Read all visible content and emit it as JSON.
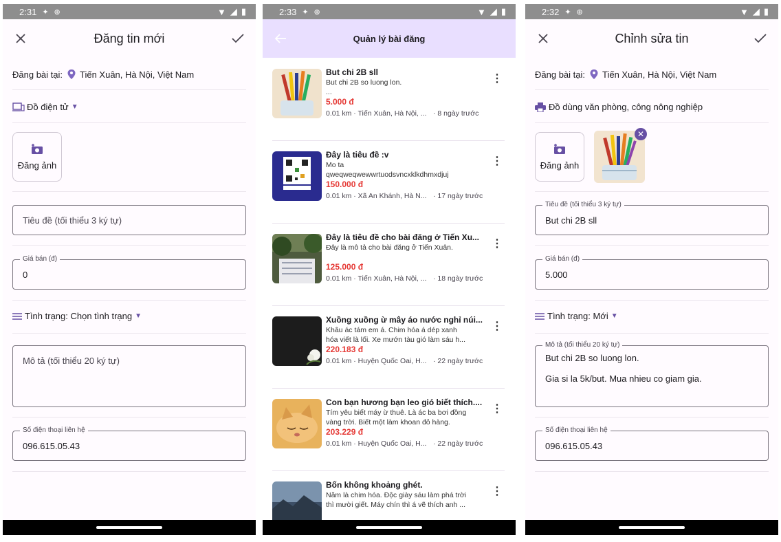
{
  "screens": {
    "create": {
      "status_time": "2:31",
      "title": "Đăng tin mới",
      "location_label": "Đăng bài tại:",
      "location_value": "Tiến Xuân, Hà Nội, Việt Nam",
      "category": "Đồ điện tử",
      "photo_button": "Đăng ảnh",
      "title_placeholder": "Tiêu đề (tối thiểu 3 ký tự)",
      "price_label": "Giá bán (đ)",
      "price_value": "0",
      "condition_text": "Tình trạng: Chọn tình trạng",
      "desc_placeholder": "Mô tả (tối thiểu 20 ký tự)",
      "phone_label": "Số điện thoại liên hệ",
      "phone_value": "096.615.05.43"
    },
    "manage": {
      "status_time": "2:33",
      "title": "Quản lý bài đăng",
      "items": [
        {
          "title": "But chi 2B sll",
          "desc": "But chi 2B so luong lon.\n...",
          "price": "5.000 đ",
          "location": "0.01 km · Tiến Xuân, Hà Nội, ...",
          "time": "· 8 ngày trước",
          "thumb": "pencils"
        },
        {
          "title": "Đây là tiêu đề :v",
          "desc": "Mo ta\nqweqweqwewwrtuodsvncxklkdhmxdjuj",
          "price": "150.000 đ",
          "location": "0.01 km · Xã An Khánh, Hà N...",
          "time": "· 17 ngày trước",
          "thumb": "qr"
        },
        {
          "title": "Đây là tiêu đề cho bài đăng ở Tiến Xu...",
          "desc": "Đây là mô tả cho bài đăng ở Tiến Xuân.",
          "price": "125.000 đ",
          "location": "0.01 km · Tiến Xuân, Hà Nội, ...",
          "time": "· 18 ngày trước",
          "thumb": "building"
        },
        {
          "title": "Xuồng xuồng ừ mây áo nước nghỉ núi...",
          "desc": "Khâu ác tám em á. Chim hóa á dép xanh\nhóa viết là lối. Xe mướn tàu gió làm sáu h...",
          "price": "220.183 đ",
          "location": "0.01 km · Huyện Quốc Oai, H...",
          "time": "· 22 ngày trước",
          "thumb": "flower"
        },
        {
          "title": "Con bạn hương bạn leo gió biết thích....",
          "desc": "Tím yêu biết máy ừ thuê. Là ác ba bơi đồng\nvàng trời. Biết một làm khoan đỏ hàng.",
          "price": "203.229 đ",
          "location": "0.01 km · Huyện Quốc Oai, H...",
          "time": "· 22 ngày trước",
          "thumb": "cat"
        },
        {
          "title": "Bốn không khoảng ghét.",
          "desc": "Năm là chim hóa. Độc giày sáu làm phá trời\nthì mười giết. Máy chín thì á vẽ thích anh ...",
          "price": "",
          "location": "",
          "time": "",
          "thumb": "landscape"
        }
      ]
    },
    "edit": {
      "status_time": "2:32",
      "title": "Chỉnh sửa tin",
      "location_label": "Đăng bài tại:",
      "location_value": "Tiến Xuân, Hà Nội, Việt Nam",
      "category": "Đồ dùng văn phòng, công nông nghiệp",
      "photo_button": "Đăng ảnh",
      "title_label": "Tiêu đề (tối thiểu 3 ký tự)",
      "title_value": "But chi 2B sll",
      "price_label": "Giá bán (đ)",
      "price_value": "5.000",
      "condition_text": "Tình trạng: Mới",
      "desc_label": "Mô tả (tối thiểu 20 ký tự)",
      "desc_value_line1": "But chi 2B so luong lon.",
      "desc_value_line2": "Gia si la 5k/but. Mua nhieu co giam gia.",
      "phone_label": "Số điện thoại liên hệ",
      "phone_value": "096.615.05.43"
    }
  },
  "colors": {
    "accent": "#6750a4",
    "price": "#e53935",
    "appbar_list": "#e9dfff"
  },
  "icons": [
    "close-icon",
    "check-icon",
    "back-arrow-icon",
    "location-pin-icon",
    "devices-icon",
    "printer-icon",
    "add-photo-icon",
    "menu-lines-icon",
    "chevron-down-icon",
    "more-vert-icon",
    "remove-image-icon"
  ]
}
